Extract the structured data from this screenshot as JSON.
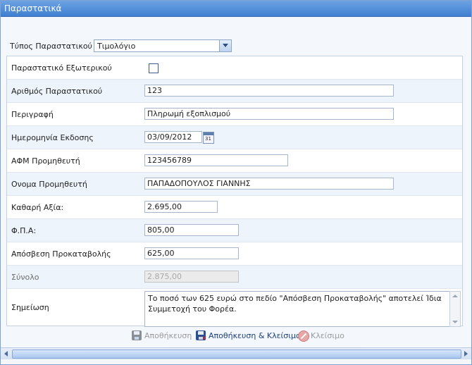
{
  "window": {
    "title": "Παραστατικά"
  },
  "doc_type": {
    "label": "Τύπος Παραστατικού",
    "value": "Τιμολόγιο"
  },
  "fields": {
    "external": {
      "label": "Παραστατικό Εξωτερικού",
      "checked": false
    },
    "number": {
      "label": "Αριθμός Παραστατικού",
      "value": "123"
    },
    "description": {
      "label": "Περιγραφή",
      "value": "Πληρωμή εξοπλισμού"
    },
    "issue_date": {
      "label": "Ημερομηνία Εκδοσης",
      "value": "03/09/2012"
    },
    "supplier_vat": {
      "label": "ΑΦΜ Προμηθευτή",
      "value": "123456789"
    },
    "supplier_name": {
      "label": "Ονομα Προμηθευτή",
      "value": "ΠΑΠΑΔΟΠΟΥΛΟΣ ΓΙΑΝΝΗΣ"
    },
    "net_value": {
      "label": "Καθαρή Αξία:",
      "value": "2.695,00"
    },
    "vat": {
      "label": "Φ.Π.Α:",
      "value": "805,00"
    },
    "advance": {
      "label": "Απόσβεση Προκαταβολής",
      "value": "625,00"
    },
    "total": {
      "label": "Σύνολο",
      "value": "2.875,00"
    },
    "note": {
      "label": "Σημείωση",
      "value": "Το ποσό των 625 ευρώ στο πεδίο \"Απόσβεση Προκαταβολής\" αποτελεί Ίδια Συμμετοχή του Φορέα."
    }
  },
  "actions": {
    "save": "Αποθήκευση",
    "save_close": "Αποθήκευση & Κλείσιμο",
    "close": "Κλείσιμο"
  }
}
